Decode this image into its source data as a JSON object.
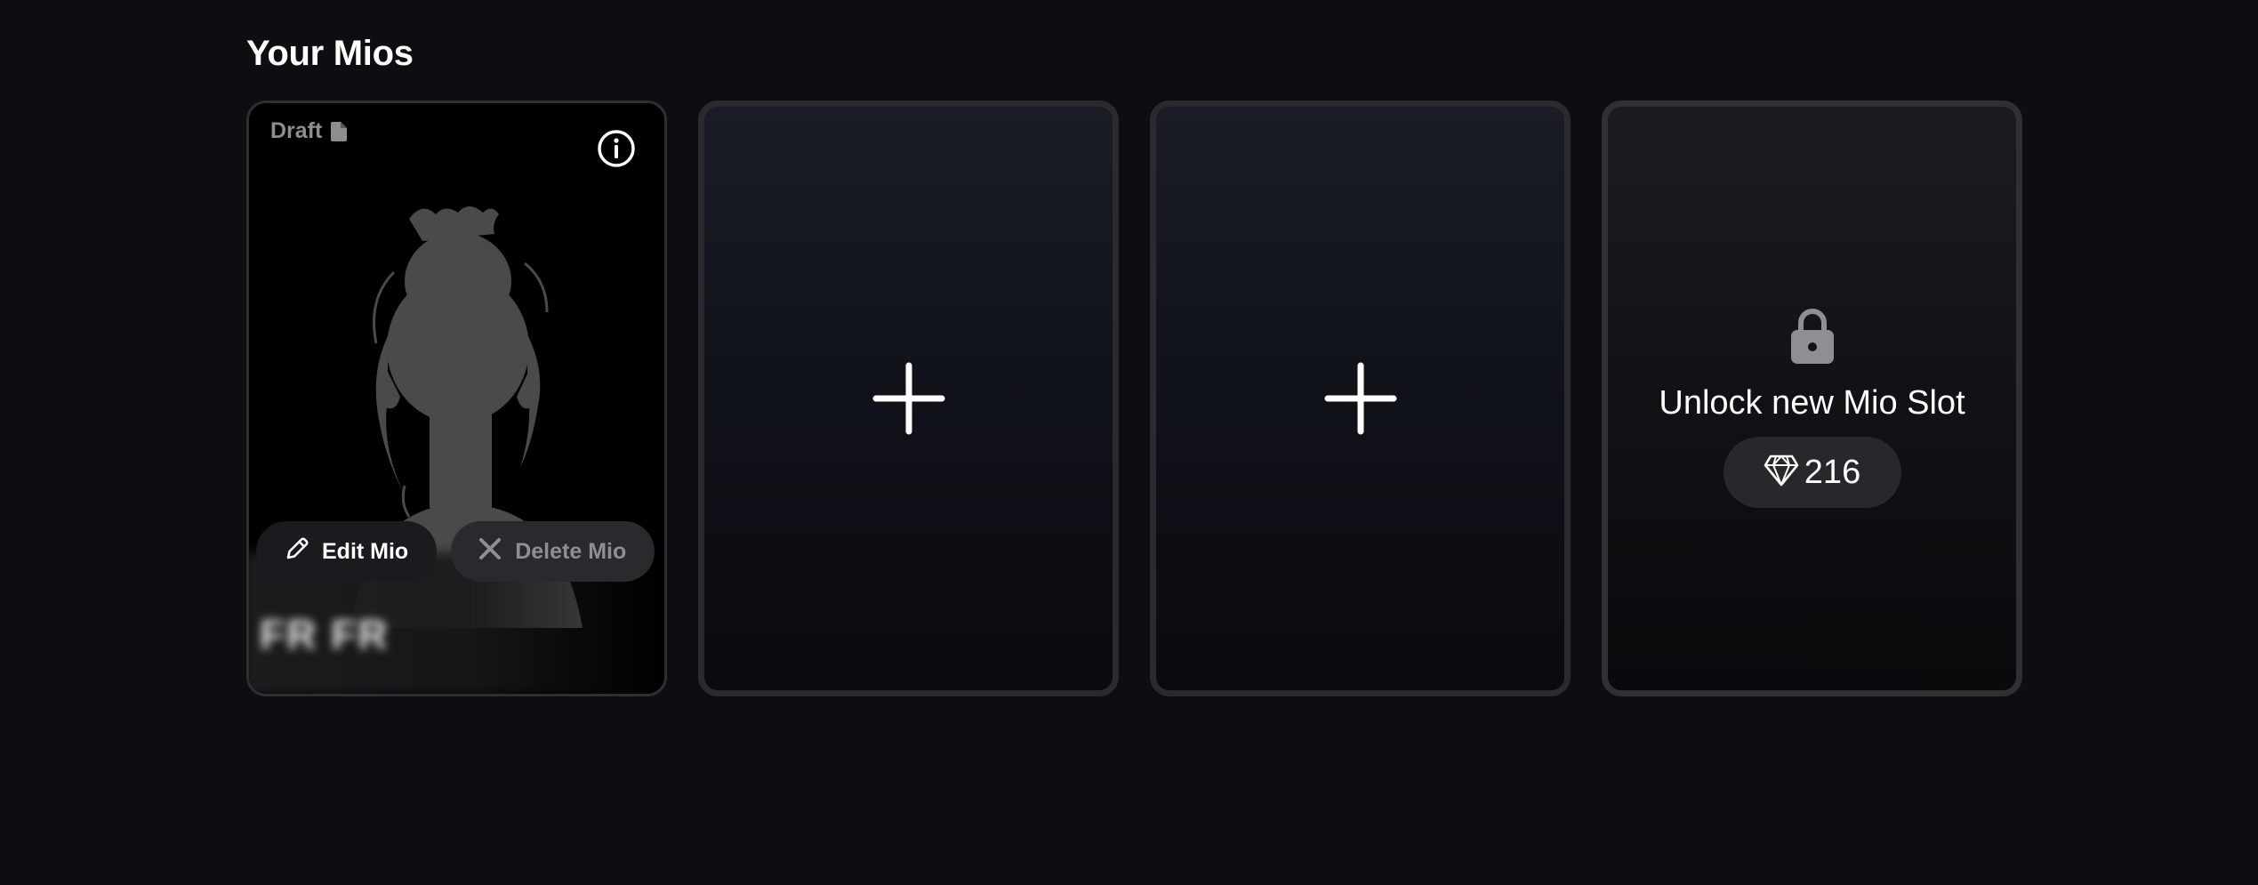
{
  "section": {
    "title": "Your Mios"
  },
  "draft_card": {
    "status_label": "Draft",
    "status_icon": "document-icon",
    "info_icon": "info-icon",
    "edit_label": "Edit Mio",
    "delete_label": "Delete Mio",
    "name": "FR FR"
  },
  "empty_slots": [
    {
      "icon": "plus-icon"
    },
    {
      "icon": "plus-icon"
    }
  ],
  "locked_slot": {
    "icon": "lock-icon",
    "label": "Unlock new Mio Slot",
    "price_icon": "gem-icon",
    "price": "216"
  },
  "colors": {
    "background": "#0d0d12",
    "card_border": "#2a2a2f",
    "muted_text": "#8d8d92",
    "silhouette": "#4a4a4a"
  }
}
